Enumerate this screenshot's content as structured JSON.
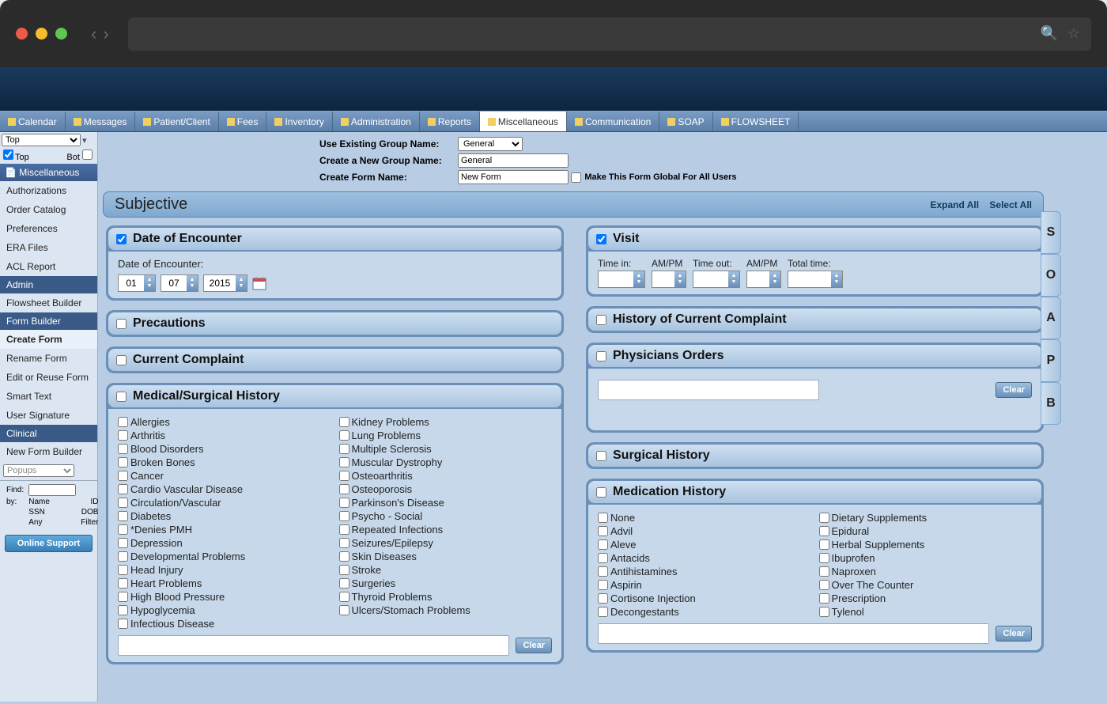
{
  "tabs": {
    "items": [
      "Calendar",
      "Messages",
      "Patient/Client",
      "Fees",
      "Inventory",
      "Administration",
      "Reports",
      "Miscellaneous",
      "Communication",
      "SOAP",
      "FLOWSHEET"
    ],
    "active": "Miscellaneous"
  },
  "sidebar": {
    "selector": "Top",
    "top_label": "Top",
    "bot_label": "Bot",
    "groups": [
      {
        "header": "Miscellaneous",
        "items": [
          "Authorizations",
          "Order Catalog",
          "Preferences",
          "ERA Files",
          "ACL Report"
        ]
      },
      {
        "header": "Admin",
        "items": [
          "Flowsheet Builder"
        ]
      },
      {
        "header": "Form Builder",
        "items": [
          "Create Form",
          "Rename Form",
          "Edit or Reuse Form",
          "Smart Text",
          "User Signature"
        ],
        "active": "Create Form"
      },
      {
        "header": "Clinical",
        "items": [
          "New Form Builder"
        ]
      }
    ],
    "popups_label": "Popups",
    "find_label": "Find:",
    "by_label": "by:",
    "find_opts": [
      "Name",
      "ID",
      "SSN",
      "DOB",
      "Any",
      "Filter"
    ],
    "support_btn": "Online Support"
  },
  "form_setup": {
    "use_group_label": "Use Existing Group Name:",
    "use_group_value": "General",
    "new_group_label": "Create a New Group Name:",
    "new_group_value": "General",
    "form_name_label": "Create Form Name:",
    "form_name_value": "New Form",
    "global_label": "Make This Form Global For All Users"
  },
  "section": {
    "title": "Subjective",
    "expand": "Expand All",
    "select": "Select All"
  },
  "panels": {
    "date": {
      "title": "Date of Encounter",
      "label": "Date of Encounter:",
      "mm": "01",
      "dd": "07",
      "yyyy": "2015"
    },
    "precautions": {
      "title": "Precautions"
    },
    "current_complaint": {
      "title": "Current Complaint"
    },
    "med_hist": {
      "title": "Medical/Surgical History",
      "left": [
        "Allergies",
        "Arthritis",
        "Blood Disorders",
        "Broken Bones",
        "Cancer",
        "Cardio Vascular Disease",
        "Circulation/Vascular",
        "Diabetes",
        "*Denies PMH",
        "Depression",
        "Developmental Problems",
        "Head Injury",
        "Heart Problems",
        "High Blood Pressure",
        "Hypoglycemia",
        "Infectious Disease"
      ],
      "right": [
        "Kidney Problems",
        "Lung Problems",
        "Multiple Sclerosis",
        "Muscular Dystrophy",
        "Osteoarthritis",
        "Osteoporosis",
        "Parkinson's Disease",
        "Psycho - Social",
        "Repeated Infections",
        "Seizures/Epilepsy",
        "Skin Diseases",
        "Stroke",
        "Surgeries",
        "Thyroid Problems",
        "Ulcers/Stomach Problems"
      ],
      "clear": "Clear"
    },
    "visit": {
      "title": "Visit",
      "time_in": "Time in:",
      "ampm": "AM/PM",
      "time_out": "Time out:",
      "total": "Total time:"
    },
    "hx_complaint": {
      "title": "History of Current Complaint"
    },
    "phys_orders": {
      "title": "Physicians Orders",
      "clear": "Clear"
    },
    "surg_hist": {
      "title": "Surgical History"
    },
    "med_history": {
      "title": "Medication History",
      "left": [
        "None",
        "Advil",
        "Aleve",
        "Antacids",
        "Antihistamines",
        "Aspirin",
        "Cortisone Injection",
        "Decongestants"
      ],
      "right": [
        "Dietary Supplements",
        "Epidural",
        "Herbal Supplements",
        "Ibuprofen",
        "Naproxen",
        "Over The Counter",
        "Prescription",
        "Tylenol"
      ],
      "clear": "Clear"
    }
  },
  "soap_tabs": [
    "S",
    "O",
    "A",
    "P",
    "B"
  ]
}
